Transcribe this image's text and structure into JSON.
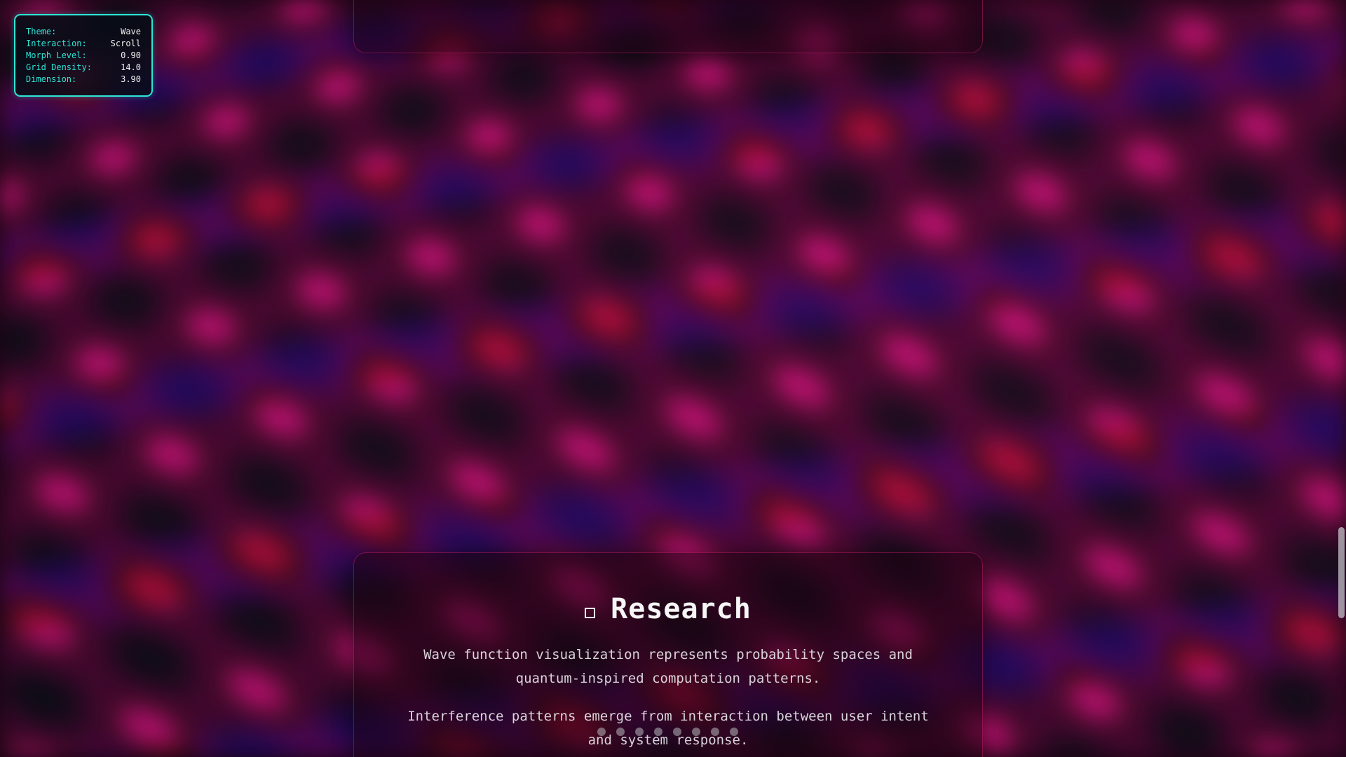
{
  "hud": {
    "rows": [
      {
        "key": "Theme:",
        "value": "Wave"
      },
      {
        "key": "Interaction:",
        "value": "Scroll"
      },
      {
        "key": "Morph Level:",
        "value": "0.90"
      },
      {
        "key": "Grid Density:",
        "value": "14.0"
      },
      {
        "key": "Dimension:",
        "value": "3.90"
      }
    ]
  },
  "section": {
    "icon": "square-outline-icon",
    "title": "Research",
    "paragraph1": "Wave function visualization represents probability spaces and quantum-inspired computation patterns.",
    "paragraph2": "Interference patterns emerge from interaction between user intent and system response."
  },
  "pager": {
    "count": 8
  },
  "scrollbar": {
    "position": 0.7
  },
  "colors": {
    "accent": "#2ee6d6",
    "wave_pink": "#ff1a7a",
    "wave_dark": "#0c0c14",
    "wave_blue": "#2a0a8c"
  }
}
